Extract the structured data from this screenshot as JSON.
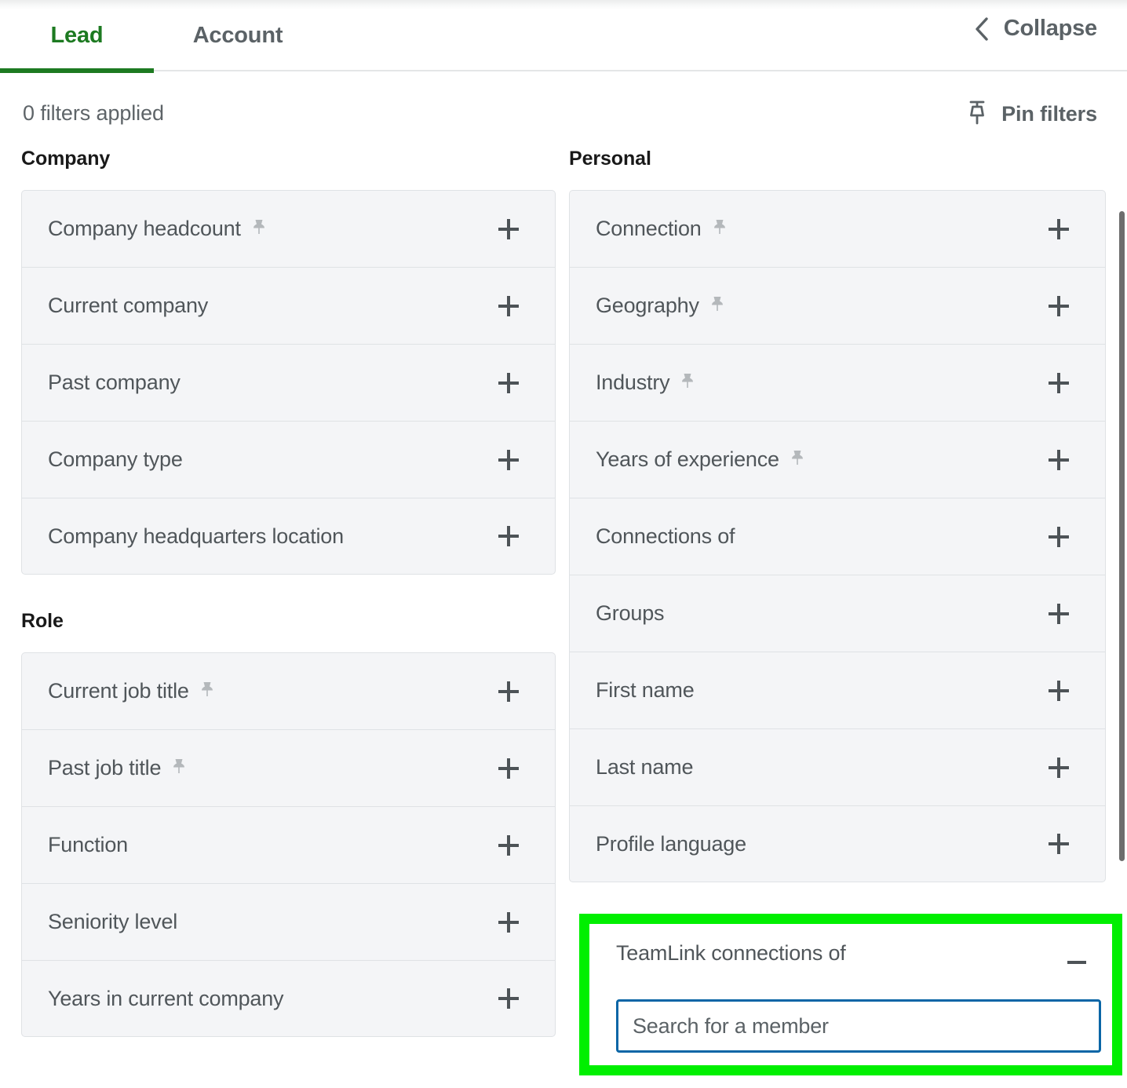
{
  "tabs": [
    {
      "label": "Lead",
      "active": true
    },
    {
      "label": "Account",
      "active": false
    }
  ],
  "collapse": {
    "label": "Collapse",
    "icon": "chevron-left-icon"
  },
  "filters_header": {
    "applied_text": "0 filters applied",
    "pin_filters_label": "Pin filters",
    "pin_icon": "pin-icon"
  },
  "colors": {
    "accent_green": "#1d7a21",
    "highlight_green": "#00ef00",
    "input_focus_blue": "#0a66a6",
    "row_bg": "#f4f5f7",
    "row_border": "#dfe2e5",
    "text_primary": "#50565a",
    "text_heading": "#191919"
  },
  "left_column": {
    "groups": [
      {
        "title": "Company",
        "items": [
          {
            "label": "Company headcount",
            "pinned": true,
            "action": "plus"
          },
          {
            "label": "Current company",
            "pinned": false,
            "action": "plus"
          },
          {
            "label": "Past company",
            "pinned": false,
            "action": "plus"
          },
          {
            "label": "Company type",
            "pinned": false,
            "action": "plus"
          },
          {
            "label": "Company headquarters location",
            "pinned": false,
            "action": "plus"
          }
        ]
      },
      {
        "title": "Role",
        "items": [
          {
            "label": "Current job title",
            "pinned": true,
            "action": "plus"
          },
          {
            "label": "Past job title",
            "pinned": true,
            "action": "plus"
          },
          {
            "label": "Function",
            "pinned": false,
            "action": "plus"
          },
          {
            "label": "Seniority level",
            "pinned": false,
            "action": "plus"
          },
          {
            "label": "Years in current company",
            "pinned": false,
            "action": "plus"
          }
        ]
      }
    ]
  },
  "right_column": {
    "groups": [
      {
        "title": "Personal",
        "items": [
          {
            "label": "Connection",
            "pinned": true,
            "action": "plus"
          },
          {
            "label": "Geography",
            "pinned": true,
            "action": "plus"
          },
          {
            "label": "Industry",
            "pinned": true,
            "action": "plus"
          },
          {
            "label": "Years of experience",
            "pinned": true,
            "action": "plus"
          },
          {
            "label": "Connections of",
            "pinned": false,
            "action": "plus"
          },
          {
            "label": "Groups",
            "pinned": false,
            "action": "plus"
          },
          {
            "label": "First name",
            "pinned": false,
            "action": "plus"
          },
          {
            "label": "Last name",
            "pinned": false,
            "action": "plus"
          },
          {
            "label": "Profile language",
            "pinned": false,
            "action": "plus"
          }
        ]
      }
    ]
  },
  "teamlink": {
    "title": "TeamLink connections of",
    "collapse_icon": "minus-icon",
    "search_placeholder": "Search for a member",
    "search_value": ""
  },
  "scrollbar": {
    "orientation": "vertical"
  }
}
